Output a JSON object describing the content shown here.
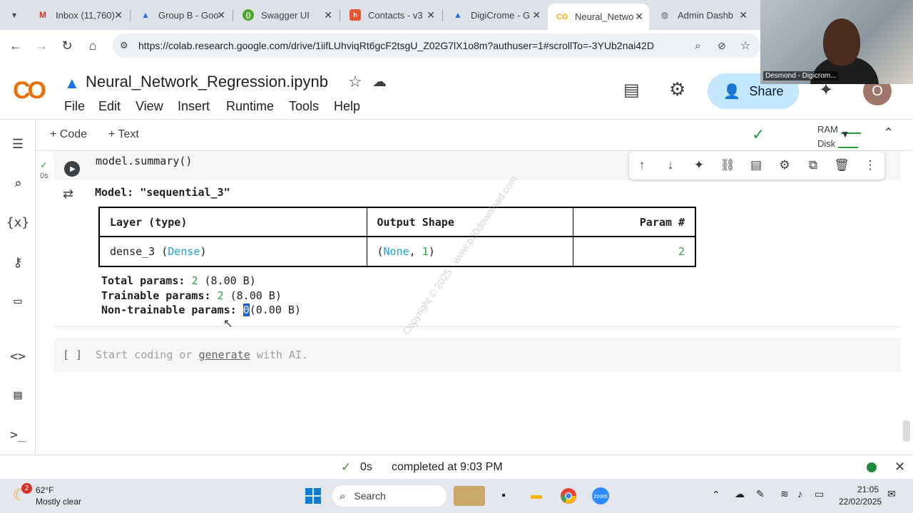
{
  "tabs": [
    {
      "title": "Inbox (11,760)",
      "icon": "gmail-icon",
      "active": false
    },
    {
      "title": "Group B - Goo",
      "icon": "drive-icon",
      "active": false
    },
    {
      "title": "Swagger UI",
      "icon": "swagger-icon",
      "active": false
    },
    {
      "title": "Contacts - v3",
      "icon": "hubspot-icon",
      "active": false
    },
    {
      "title": "DigiCrome - G",
      "icon": "drive-icon",
      "active": false
    },
    {
      "title": "Neural_Netwo",
      "icon": "colab-icon",
      "active": true
    },
    {
      "title": "Admin Dashb",
      "icon": "globe-icon",
      "active": false
    }
  ],
  "browser": {
    "url": "https://colab.research.google.com/drive/1iifLUhviqRt6gcF2tsgU_Z02G7lX1o8m?authuser=1#scrollTo=-3YUb2nai42D"
  },
  "webcam": {
    "label": "Desmond - Digicrom..."
  },
  "colab": {
    "logo": "CO",
    "title": "Neural_Network_Regression.ipynb",
    "menu": [
      "File",
      "Edit",
      "View",
      "Insert",
      "Runtime",
      "Tools",
      "Help"
    ],
    "share_label": "Share",
    "avatar_letter": "O",
    "add_code": "+ Code",
    "add_text": "+ Text",
    "ram_label": "RAM",
    "disk_label": "Disk"
  },
  "cell1": {
    "code": "model.summary()",
    "exec_time": "0s",
    "model_title": "Model: \"sequential_3\"",
    "table": {
      "headers": [
        "Layer (type)",
        "Output Shape",
        "Param #"
      ],
      "row": {
        "layer_name": "dense_3",
        "layer_type": "Dense",
        "shape_none": "None",
        "shape_dim": "1",
        "params": "2"
      }
    },
    "total_label": "Total params:",
    "total_value": "2",
    "total_size": "(8.00 B)",
    "trainable_label": "Trainable params:",
    "trainable_value": "2",
    "trainable_size": "(8.00 B)",
    "nontrainable_label": "Non-trainable params:",
    "nontrainable_value": "0",
    "nontrainable_size": "(0.00 B)"
  },
  "cell2": {
    "brackets": "[ ]",
    "placeholder_pre": "Start coding or",
    "placeholder_link": "generate",
    "placeholder_post": "with AI."
  },
  "statusbar": {
    "time": "0s",
    "message": "completed at 9:03 PM"
  },
  "taskbar": {
    "weather_temp": "62°F",
    "weather_desc": "Mostly clear",
    "weather_badge": "2",
    "search_label": "Search",
    "clock_time": "21:05",
    "clock_date": "22/02/2025"
  },
  "watermark": "Copyright © 2025 - www.p30download.com",
  "colors": {
    "accent_green": "#2e9e3c",
    "accent_blue": "#1aa1e0",
    "share_bg": "#c2e7ff"
  }
}
